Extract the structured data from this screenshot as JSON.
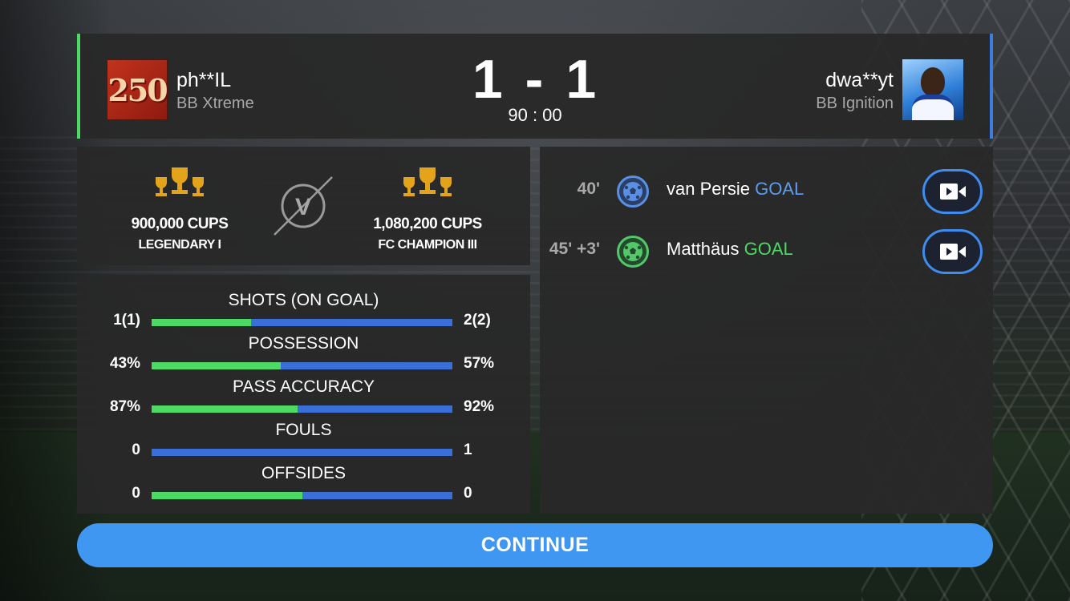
{
  "header": {
    "home": {
      "badge_text": "250",
      "name": "ph**IL",
      "team": "BB Xtreme",
      "accent": "#4cd964"
    },
    "away": {
      "name": "dwa**yt",
      "team": "BB Ignition",
      "accent": "#3d7de0"
    },
    "score_home": "1",
    "score_sep": "-",
    "score_away": "1",
    "time": "90 : 00"
  },
  "cups": {
    "home": {
      "count": "900,000 CUPS",
      "division": "LEGENDARY I"
    },
    "away": {
      "count": "1,080,200 CUPS",
      "division": "FC CHAMPION III"
    },
    "vs_label": "V"
  },
  "stats": [
    {
      "label": "SHOTS (ON GOAL)",
      "home": "1(1)",
      "away": "2(2)",
      "home_share": 0.33
    },
    {
      "label": "POSSESSION",
      "home": "43%",
      "away": "57%",
      "home_share": 0.43
    },
    {
      "label": "PASS ACCURACY",
      "home": "87%",
      "away": "92%",
      "home_share": 0.486
    },
    {
      "label": "FOULS",
      "home": "0",
      "away": "1",
      "home_share": 0.0
    },
    {
      "label": "OFFSIDES",
      "home": "0",
      "away": "0",
      "home_share": 0.5
    }
  ],
  "events": [
    {
      "minute": "40'",
      "player": "van Persie",
      "type": "GOAL",
      "team": "away",
      "color": "#5c9cf0",
      "icon": "soccer-ball-icon"
    },
    {
      "minute": "45' +3'",
      "player": "Matthäus",
      "type": "GOAL",
      "team": "home",
      "color": "#4cd964",
      "icon": "soccer-ball-icon"
    }
  ],
  "colors": {
    "home": "#4cd964",
    "away": "#3a6fd8",
    "button": "#4097f2"
  },
  "continue_label": "CONTINUE"
}
